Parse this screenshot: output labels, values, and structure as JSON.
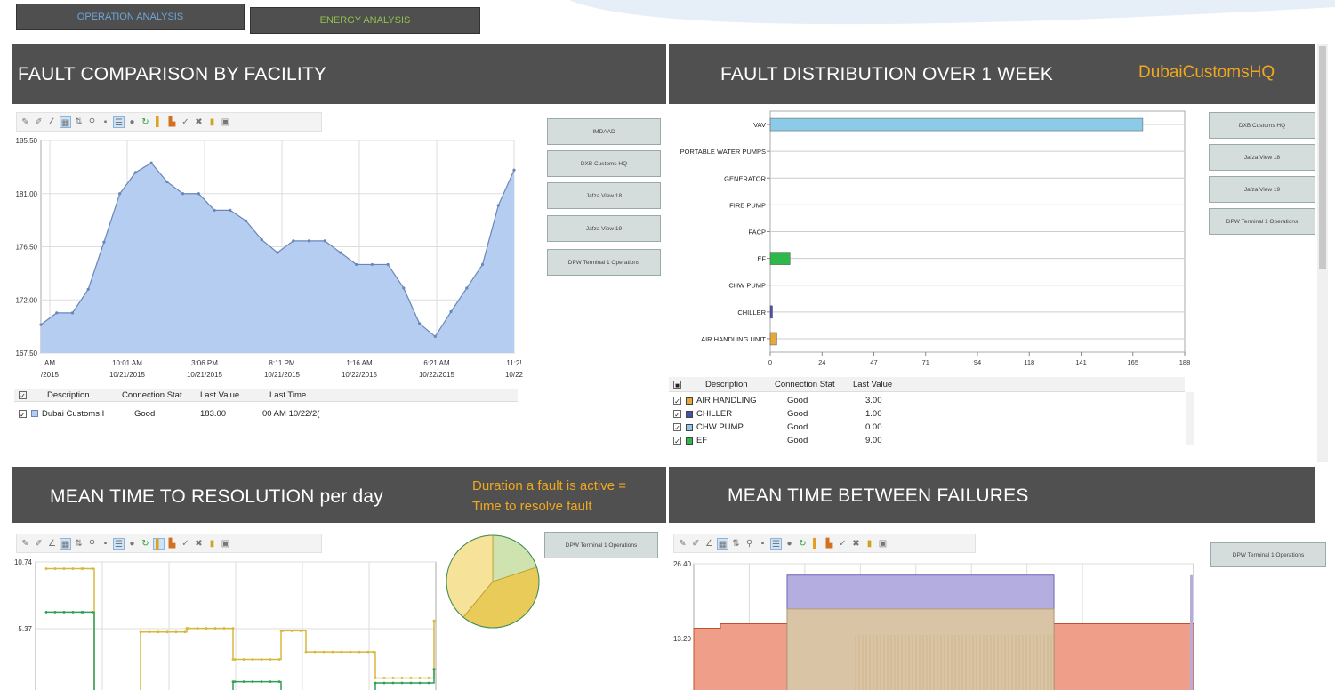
{
  "tabs": [
    {
      "label": "OPERATION ANALYSIS"
    },
    {
      "label": "ENERGY ANALYSIS"
    }
  ],
  "panels": {
    "fault_comparison": {
      "title": "FAULT COMPARISON BY FACILITY",
      "facilities": [
        "IMDAAD",
        "DXB Customs HQ",
        "Jafza View 18",
        "Jafza View 19",
        "DPW Terminal 1 Operations"
      ],
      "legend": {
        "headers": [
          "Description",
          "Connection Stat",
          "Last Value",
          "Last Time"
        ],
        "rows": [
          {
            "description": "Dubai Customs I",
            "status": "Good",
            "last_value": "183.00",
            "last_time": "00 AM 10/22/2("
          }
        ]
      }
    },
    "fault_distribution": {
      "title": "FAULT DISTRIBUTION OVER 1 WEEK",
      "site": "DubaiCustomsHQ",
      "facilities": [
        "DXB Customs HQ",
        "Jafza View 18",
        "Jafza View 19",
        "DPW Terminal 1 Operations"
      ],
      "legend": {
        "headers": [
          "Description",
          "Connection Stat",
          "Last Value"
        ],
        "rows": [
          {
            "description": "AIR HANDLING I",
            "status": "Good",
            "last_value": "3.00",
            "color": "#e8a838"
          },
          {
            "description": "CHILLER",
            "status": "Good",
            "last_value": "1.00",
            "color": "#4a4fa8"
          },
          {
            "description": "CHW PUMP",
            "status": "Good",
            "last_value": "0.00",
            "color": "#8ec8e8"
          },
          {
            "description": "EF",
            "status": "Good",
            "last_value": "9.00",
            "color": "#2db84a"
          }
        ]
      }
    },
    "mttr": {
      "title": "MEAN TIME TO RESOLUTION per day",
      "note_line1": "Duration a fault is active =",
      "note_line2": "Time to resolve fault",
      "facility_button": "DPW Terminal 1 Operations"
    },
    "mtbf": {
      "title": "MEAN TIME BETWEEN FAILURES",
      "facility_button": "DPW Terminal 1 Operations"
    }
  },
  "colors": {
    "header_bg": "#505050",
    "accent_orange": "#f0a81e",
    "area_fill": "#b4cdf0",
    "area_line": "#6a86b8",
    "bar_vav": "#8ccbe8",
    "bar_ef": "#2db84a"
  },
  "chart_data": [
    {
      "type": "area",
      "title": "FAULT COMPARISON BY FACILITY",
      "series": [
        {
          "name": "Dubai Customs I",
          "values": [
            169.9,
            170.9,
            170.9,
            172.9,
            176.9,
            181.0,
            182.8,
            183.6,
            182.0,
            181.0,
            181.0,
            179.6,
            179.6,
            178.7,
            177.1,
            176.0,
            177.0,
            177.0,
            177.0,
            176.0,
            175.0,
            175.0,
            175.0,
            173.0,
            170.0,
            168.9,
            171.0,
            173.0,
            175.0,
            180.0,
            183.0
          ]
        }
      ],
      "x_tick_labels": [
        "AM /2015",
        "10:01 AM 10/21/2015",
        "3:06 PM 10/21/2015",
        "8:11 PM 10/21/2015",
        "1:16 AM 10/22/2015",
        "6:21 AM 10/22/2015",
        "11:2! 10/22"
      ],
      "ylim": [
        167.5,
        185.5
      ],
      "y_ticks": [
        "185.50",
        "181.00",
        "176.50",
        "172.00",
        "167.50"
      ],
      "grid": true
    },
    {
      "type": "bar",
      "orientation": "horizontal",
      "title": "FAULT DISTRIBUTION OVER 1 WEEK",
      "categories": [
        "VAV",
        "PORTABLE WATER PUMPS",
        "GENERATOR",
        "FIRE PUMP",
        "FACP",
        "EF",
        "CHW PUMP",
        "CHILLER",
        "AIR HANDLING UNIT"
      ],
      "values": [
        169,
        0,
        0,
        0,
        0,
        9,
        0,
        1,
        3
      ],
      "colors": [
        "#8ccbe8",
        "#8ccbe8",
        "#8ccbe8",
        "#8ccbe8",
        "#8ccbe8",
        "#2db84a",
        "#8ec8e8",
        "#4a4fa8",
        "#e8a838"
      ],
      "xlim": [
        0,
        188
      ],
      "x_ticks": [
        "0",
        "24",
        "47",
        "71",
        "94",
        "118",
        "141",
        "165",
        "188"
      ],
      "grid": true
    },
    {
      "type": "line",
      "title": "MEAN TIME TO RESOLUTION per day",
      "ylim": [
        0,
        10.74
      ],
      "y_ticks": [
        "10.74",
        "5.37"
      ],
      "series": [
        {
          "name": "",
          "color": "#d6b83a",
          "values": [
            10.2,
            10.2,
            0.2,
            5.1,
            5.4,
            5.4,
            2.9,
            2.9,
            5.2,
            5.2,
            3.5,
            3.5,
            1.4,
            6.0
          ]
        },
        {
          "name": "",
          "color": "#2e9e58",
          "values": [
            6.7,
            6.7,
            0.1,
            0.1,
            0.1,
            0.1,
            1.1,
            1.1,
            0.1,
            0.1,
            0.1,
            0.1,
            1.0,
            2.1
          ]
        }
      ],
      "grid": true
    },
    {
      "type": "pie",
      "slices": [
        {
          "value": 20,
          "color": "#cfe3b0"
        },
        {
          "value": 41,
          "color": "#e8cb58"
        },
        {
          "value": 39,
          "color": "#f7e29a"
        }
      ]
    },
    {
      "type": "area",
      "title": "MEAN TIME BETWEEN FAILURES",
      "ylim": [
        0,
        26.4
      ],
      "y_ticks": [
        "26.40",
        "13.20"
      ],
      "series": [
        {
          "name": "",
          "color": "#ef9e8a",
          "values": [
            15.0,
            15.8,
            15.8,
            15.8
          ]
        },
        {
          "name": "",
          "color": "#b4aee0",
          "values": [
            0,
            24.4,
            24.4,
            0
          ]
        },
        {
          "name": "",
          "color": "#dfc89a",
          "values": [
            0,
            18.4,
            18.4,
            0
          ]
        }
      ],
      "grid": true
    }
  ]
}
